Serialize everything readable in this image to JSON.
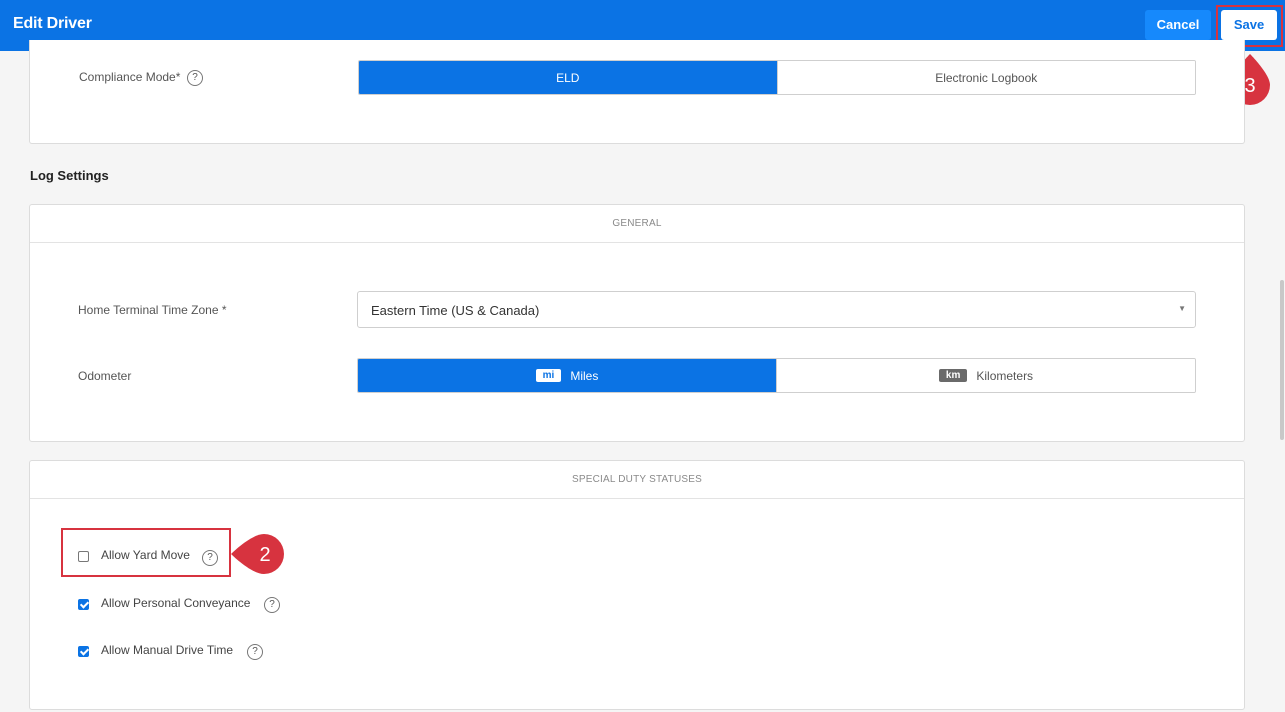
{
  "header": {
    "title": "Edit Driver",
    "cancel_label": "Cancel",
    "save_label": "Save"
  },
  "compliance": {
    "label": "Compliance Mode*",
    "options": [
      "ELD",
      "Electronic Logbook"
    ],
    "selected": "ELD"
  },
  "log_settings": {
    "title": "Log Settings",
    "general": {
      "heading": "GENERAL",
      "timezone": {
        "label": "Home Terminal Time Zone *",
        "value": "Eastern Time (US & Canada)"
      },
      "odometer": {
        "label": "Odometer",
        "options": [
          {
            "abbr": "mi",
            "label": "Miles"
          },
          {
            "abbr": "km",
            "label": "Kilometers"
          }
        ],
        "selected": "Miles"
      }
    },
    "special": {
      "heading": "SPECIAL DUTY STATUSES",
      "items": [
        {
          "label": "Allow Yard Move",
          "checked": false
        },
        {
          "label": "Allow Personal Conveyance",
          "checked": true
        },
        {
          "label": "Allow Manual Drive Time",
          "checked": true
        }
      ]
    }
  },
  "help_glyph": "?",
  "caret_glyph": "▼",
  "annotations": {
    "step_2": "2",
    "step_3": "3"
  },
  "colors": {
    "header_blue": "#0b73e4",
    "cancel_blue": "#1689fc",
    "highlight_red": "#d7333f"
  }
}
